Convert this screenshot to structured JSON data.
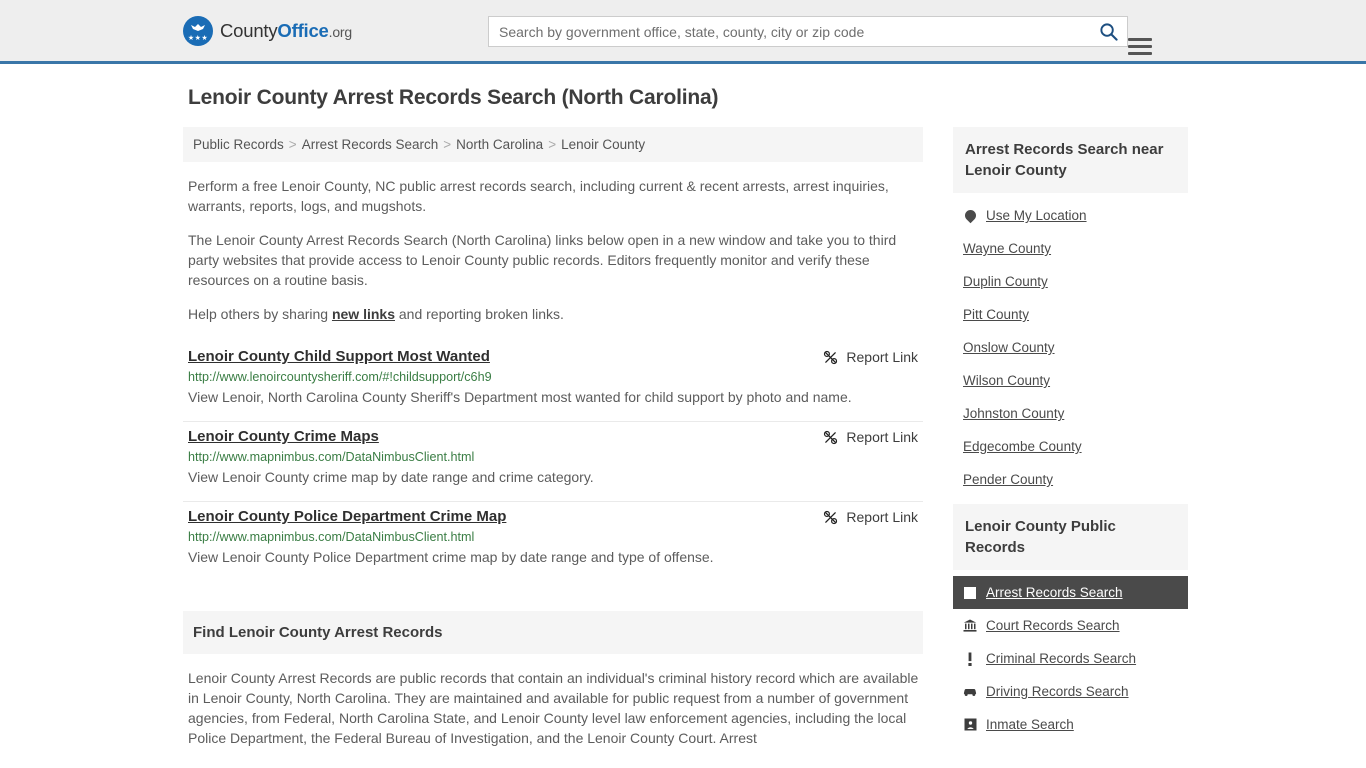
{
  "header": {
    "brand": {
      "part1": "County",
      "part2": "Office",
      "part3": ".org",
      "logo_icon": "eagle-shield-logo",
      "stars": "★★★"
    },
    "search": {
      "placeholder": "Search by government office, state, county, city or zip code",
      "value": "",
      "search_icon": "search-icon"
    },
    "menu_icon": "hamburger-menu-icon",
    "accent_color": "#3a76a8"
  },
  "page": {
    "title": "Lenoir County Arrest Records Search (North Carolina)"
  },
  "breadcrumb": {
    "items": [
      "Public Records",
      "Arrest Records Search",
      "North Carolina",
      "Lenoir County"
    ],
    "separator": ">"
  },
  "intro": {
    "p1": "Perform a free Lenoir County, NC public arrest records search, including current & recent arrests, arrest inquiries, warrants, reports, logs, and mugshots.",
    "p2": "The Lenoir County Arrest Records Search (North Carolina) links below open in a new window and take you to third party websites that provide access to Lenoir County public records. Editors frequently monitor and verify these resources on a routine basis.",
    "p3_before": "Help others by sharing ",
    "p3_link": "new links",
    "p3_after": " and reporting broken links."
  },
  "links": {
    "report_label": "Report Link",
    "report_icon": "broken-link-icon",
    "items": [
      {
        "title": "Lenoir County Child Support Most Wanted",
        "url": "http://www.lenoircountysheriff.com/#!childsupport/c6h9",
        "description": "View Lenoir, North Carolina County Sheriff's Department most wanted for child support by photo and name."
      },
      {
        "title": "Lenoir County Crime Maps",
        "url": "http://www.mapnimbus.com/DataNimbusClient.html",
        "description": "View Lenoir County crime map by date range and crime category."
      },
      {
        "title": "Lenoir County Police Department Crime Map",
        "url": "http://www.mapnimbus.com/DataNimbusClient.html",
        "description": "View Lenoir County Police Department crime map by date range and type of offense."
      }
    ]
  },
  "find_section": {
    "heading": "Find Lenoir County Arrest Records",
    "body": "Lenoir County Arrest Records are public records that contain an individual's criminal history record which are available in Lenoir County, North Carolina. They are maintained and available for public request from a number of government agencies, from Federal, North Carolina State, and Lenoir County level law enforcement agencies, including the local Police Department, the Federal Bureau of Investigation, and the Lenoir County Court. Arrest"
  },
  "sidebar": {
    "nearby": {
      "title": "Arrest Records Search near Lenoir County",
      "use_my_location": {
        "label": "Use My Location",
        "icon": "map-pin-icon"
      },
      "counties": [
        "Wayne County",
        "Duplin County",
        "Pitt County",
        "Onslow County",
        "Wilson County",
        "Johnston County",
        "Edgecombe County",
        "Pender County"
      ]
    },
    "public_records": {
      "title": "Lenoir County Public Records",
      "items": [
        {
          "label": "Arrest Records Search",
          "icon": "fingerprint-card-icon",
          "glyph": "",
          "active": true
        },
        {
          "label": "Court Records Search",
          "icon": "courthouse-icon",
          "glyph": "\u0001",
          "active": false
        },
        {
          "label": "Criminal Records Search",
          "icon": "exclamation-icon",
          "glyph": "!",
          "active": false
        },
        {
          "label": "Driving Records Search",
          "icon": "car-icon",
          "glyph": "",
          "active": false
        },
        {
          "label": "Inmate Search",
          "icon": "inmate-icon",
          "glyph": "",
          "active": false
        }
      ]
    }
  }
}
